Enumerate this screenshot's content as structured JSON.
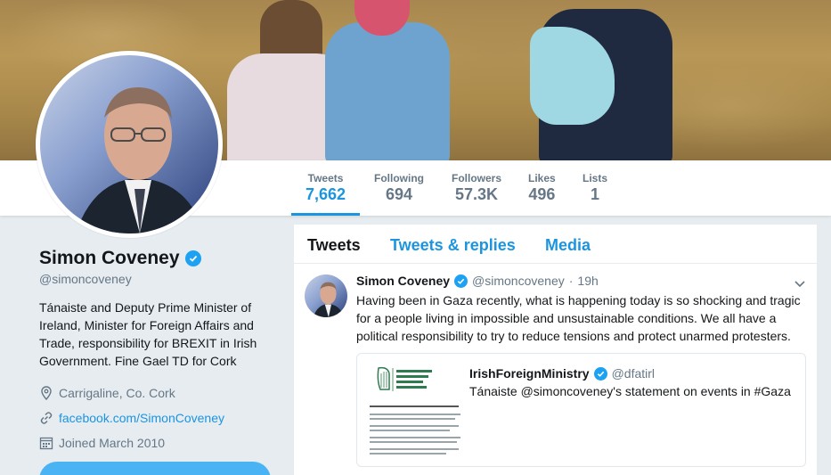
{
  "profile": {
    "name": "Simon Coveney",
    "handle": "@simoncoveney",
    "bio": "Tánaiste and Deputy Prime Minister of Ireland, Minister for Foreign Affairs and Trade, responsibility for BREXIT in Irish Government. Fine Gael TD for Cork",
    "location": "Carrigaline, Co. Cork",
    "website": "facebook.com/SimonCoveney",
    "joined": "Joined March 2010"
  },
  "stats": [
    {
      "label": "Tweets",
      "value": "7,662"
    },
    {
      "label": "Following",
      "value": "694"
    },
    {
      "label": "Followers",
      "value": "57.3K"
    },
    {
      "label": "Likes",
      "value": "496"
    },
    {
      "label": "Lists",
      "value": "1"
    }
  ],
  "tabs": [
    "Tweets",
    "Tweets & replies",
    "Media"
  ],
  "tweet": {
    "name": "Simon Coveney",
    "handle": "@simoncoveney",
    "separator": "·",
    "time": "19h",
    "text": "Having been in Gaza recently, what is happening today is so shocking and tragic for a people living in impossible and unsustainable conditions. We all have a political responsibility to try to reduce tensions and protect unarmed protesters."
  },
  "card": {
    "name": "IrishForeignMinistry",
    "handle": "@dfatirl",
    "text": "Tánaiste @simoncoveney's statement on events in #Gaza"
  },
  "colors": {
    "accent": "#1b95e0",
    "verified": "#1da1f2",
    "muted": "#657786",
    "background": "#e6ecf0"
  }
}
